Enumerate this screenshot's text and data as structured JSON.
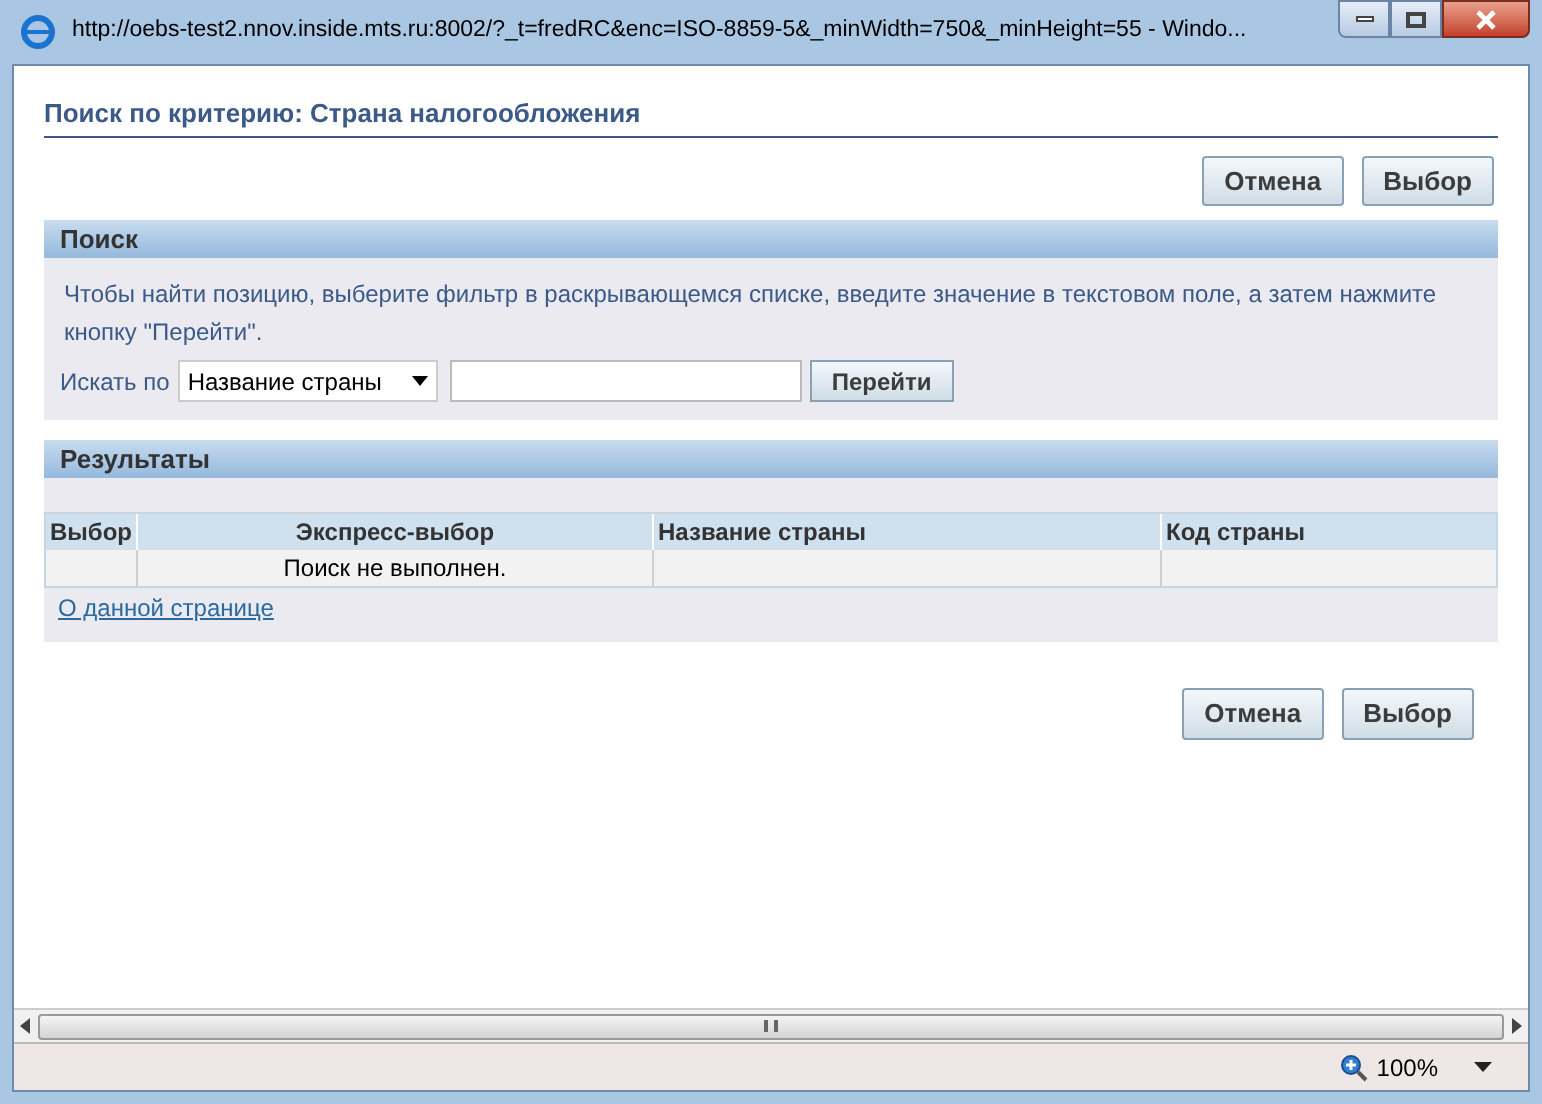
{
  "window": {
    "title": "http://oebs-test2.nnov.inside.mts.ru:8002/?_t=fredRC&enc=ISO-8859-5&_minWidth=750&_minHeight=55 - Windo..."
  },
  "page_title": "Поиск по критерию: Страна налогообложения",
  "top_buttons": [
    "Отмена",
    "Выбор"
  ],
  "search": {
    "header": "Поиск",
    "instructions": "Чтобы найти позицию, выберите фильтр в раскрывающемся списке, введите значение в текстовом поле, а затем нажмите кнопку \"Перейти\".",
    "search_by_label": "Искать по",
    "filter_value": "Название страны",
    "go_button": "Перейти"
  },
  "results": {
    "header": "Результаты",
    "columns": [
      "Выбор",
      "Экспресс-выбор",
      "Название страны",
      "Код страны"
    ],
    "empty_message": "Поиск не выполнен.",
    "about_link": "О данной странице"
  },
  "bottom_buttons": [
    "Отмена",
    "Выбор"
  ],
  "status_bar": {
    "zoom": "100%"
  }
}
